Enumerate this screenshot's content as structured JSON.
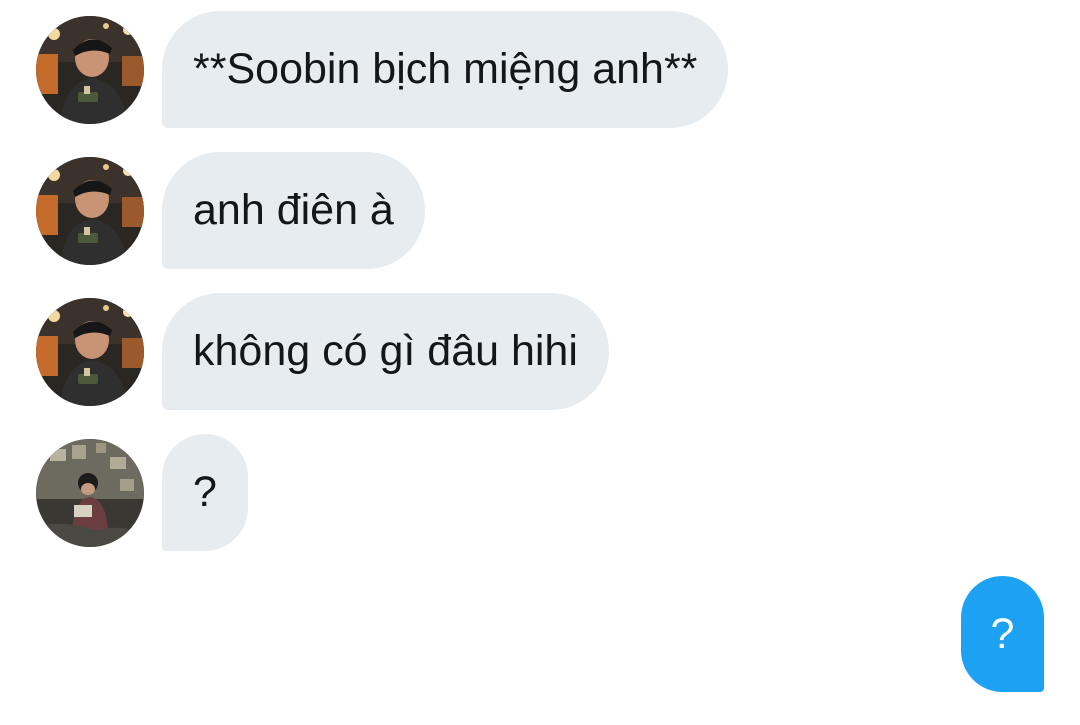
{
  "conversation": {
    "messages": [
      {
        "sender": "other-a",
        "avatar_icon": "profile-photo-avatar-cap",
        "text": "**Soobin bịch miệng anh**"
      },
      {
        "sender": "other-a",
        "avatar_icon": "profile-photo-avatar-cap",
        "text": "anh điên à"
      },
      {
        "sender": "other-a",
        "avatar_icon": "profile-photo-avatar-cap",
        "text": "không có gì đâu hihi"
      },
      {
        "sender": "other-b",
        "avatar_icon": "profile-photo-avatar-sitting",
        "text": "?"
      }
    ],
    "sent": {
      "text": "?"
    }
  },
  "colors": {
    "received_bubble": "#e6ecf0",
    "received_text": "#14171a",
    "sent_bubble": "#1da1f2",
    "sent_text": "#ffffff"
  }
}
